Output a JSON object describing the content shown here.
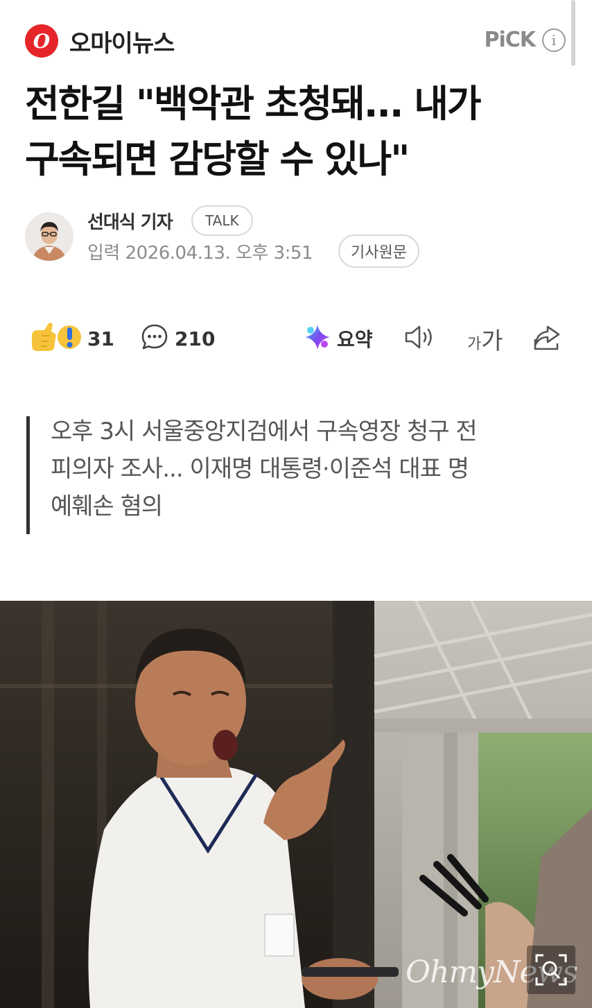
{
  "press": {
    "logo_letter": "O",
    "name": "오마이뉴스",
    "pick_label": "PiCK",
    "brand_color": "#e5252a"
  },
  "headline": {
    "line1": "전한길 \"백악관 초청돼... 내가",
    "line2": "구속되면 감당할 수 있나\""
  },
  "byline": {
    "reporter": "선대식 기자",
    "talk_label": "TALK",
    "date": "입력 2026.04.13. 오후 3:51",
    "original_label": "기사원문"
  },
  "toolbar": {
    "reaction_count": "31",
    "comment_count": "210",
    "summary_label": "요약",
    "font_small": "가",
    "font_large": "가",
    "icons": [
      "reaction-emoji-icon",
      "comment-icon",
      "ai-summary-icon",
      "speaker-icon",
      "font-size-icon",
      "share-icon"
    ]
  },
  "subhead": {
    "line1": "오후 3시 서울중앙지검에서 구속영장 청구 전",
    "line2": "피의자 조사... 이재명 대통령·이준석 대표 명",
    "line3": "예훼손 혐의"
  },
  "photo": {
    "watermark": "OhmyNews",
    "expand_icon": "magnify-expand-icon"
  }
}
